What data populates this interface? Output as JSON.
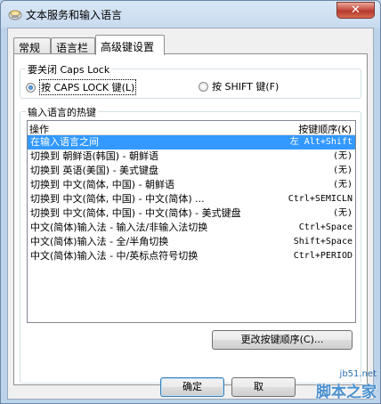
{
  "window": {
    "title": "文本服务和输入语言",
    "close_label": "✕"
  },
  "tabs": [
    {
      "label": "常规",
      "active": false
    },
    {
      "label": "语言栏",
      "active": false
    },
    {
      "label": "高级键设置",
      "active": true
    }
  ],
  "caps_lock": {
    "group_label": "要关闭 Caps Lock",
    "option_caps": "按 CAPS LOCK 键(L)",
    "option_shift": "按 SHIFT 键(F)",
    "selected": "caps"
  },
  "hotkeys": {
    "group_label": "输入语言的热键",
    "col_action": "操作",
    "col_keys": "按键顺序(K)",
    "rows": [
      {
        "name": "在输入语言之间",
        "keys": "左 Alt+Shift",
        "selected": true
      },
      {
        "name": "切换到 朝鲜语(韩国) - 朝鲜语",
        "keys": "(无)",
        "selected": false
      },
      {
        "name": "切换到 英语(美国) - 美式键盘",
        "keys": "(无)",
        "selected": false
      },
      {
        "name": "切换到 中文(简体, 中国) - 朝鲜语",
        "keys": "(无)",
        "selected": false
      },
      {
        "name": "切换到 中文(简体, 中国) - 中文(简体) ...",
        "keys": "Ctrl+SEMICLN",
        "selected": false
      },
      {
        "name": "切换到 中文(简体, 中国) - 中文(简体) - 美式键盘",
        "keys": "(无)",
        "selected": false
      },
      {
        "name": "中文(简体)输入法 - 输入法/非输入法切换",
        "keys": "Ctrl+Space",
        "selected": false
      },
      {
        "name": "中文(简体)输入法 - 全/半角切换",
        "keys": "Shift+Space",
        "selected": false
      },
      {
        "name": "中文(简体)输入法 - 中/英标点符号切换",
        "keys": "Ctrl+PERIOD",
        "selected": false
      }
    ],
    "change_button": "更改按键顺序(C)..."
  },
  "footer": {
    "ok_button": "确定",
    "cancel_button": "取"
  },
  "watermark": {
    "site": "jb51.net",
    "name": "脚本之家"
  }
}
